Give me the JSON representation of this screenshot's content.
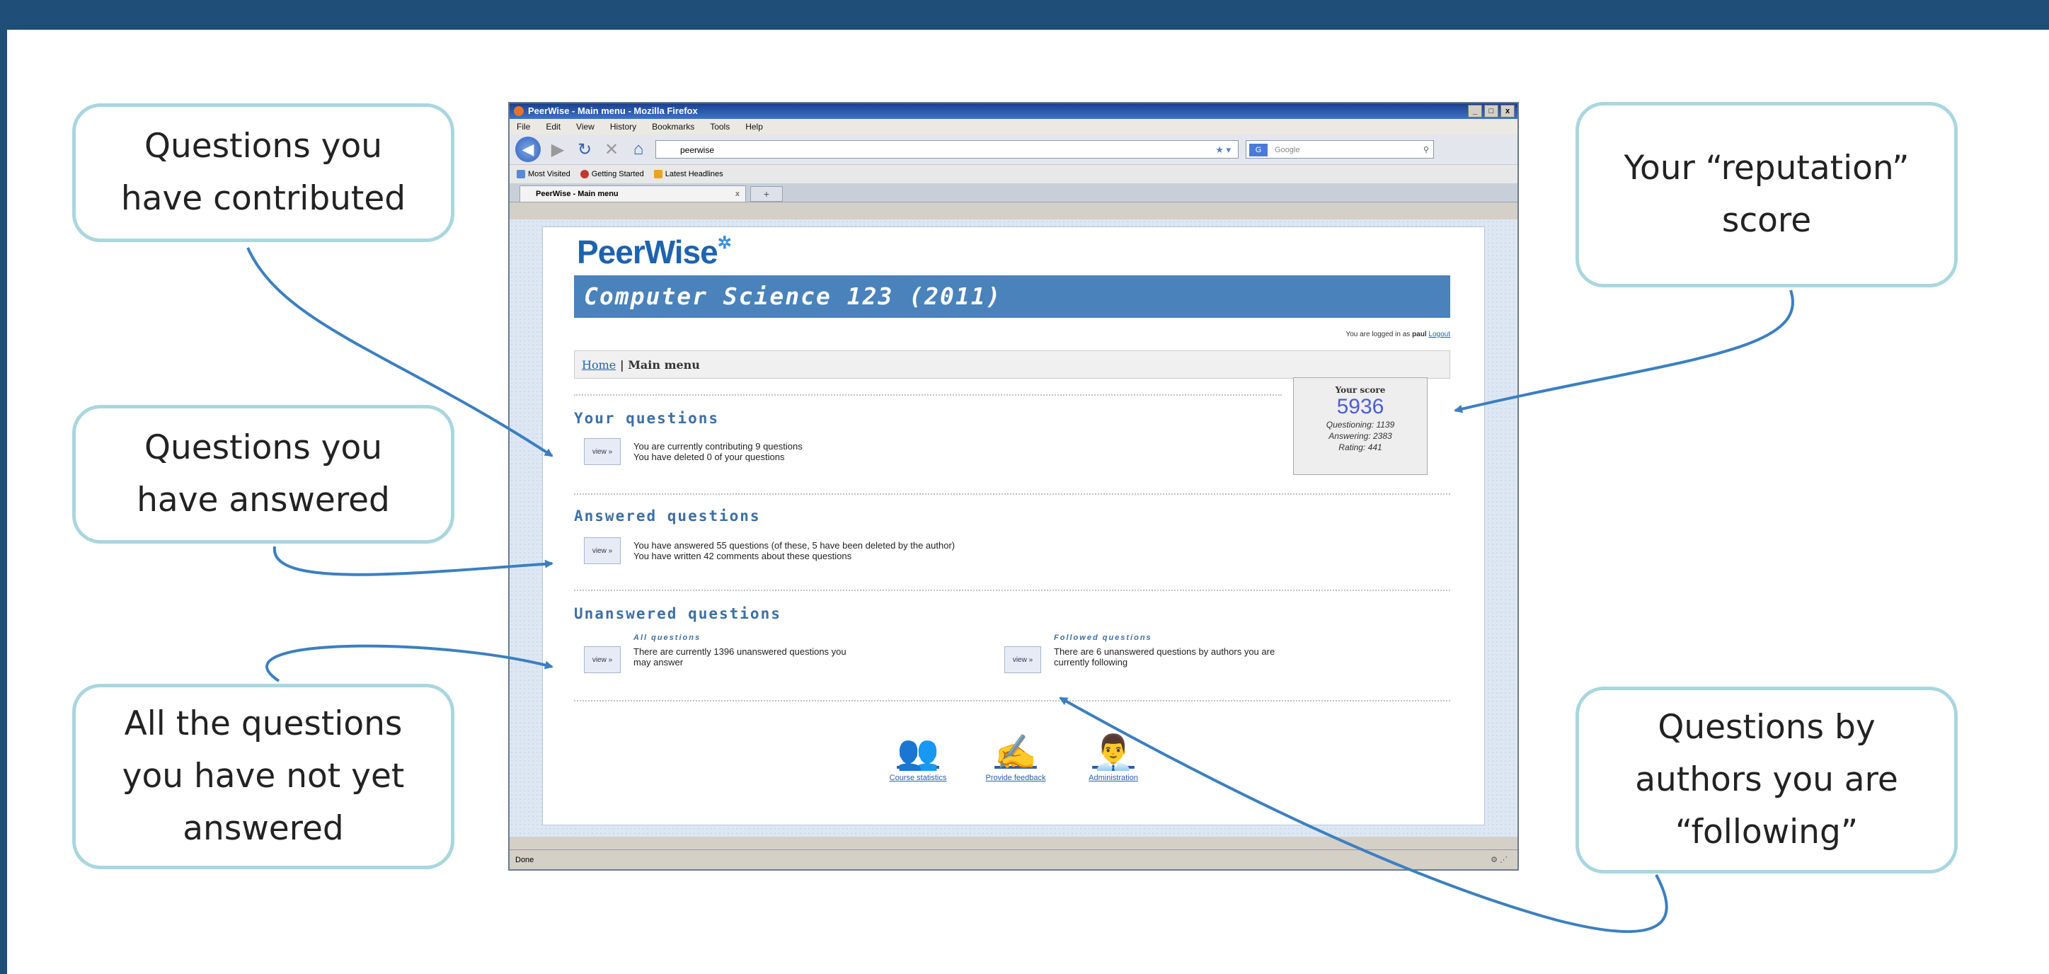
{
  "colors": {
    "background": "#1f4e79",
    "callout_border": "#a9d6df",
    "arrow": "#3b7fc0",
    "course_banner": "#4a82bb",
    "score": "#4b5ed4"
  },
  "callouts": {
    "contributed": "Questions you\nhave contributed",
    "answered": "Questions you\nhave answered",
    "not_answered": "All the questions\nyou have not yet\nanswered",
    "reputation": "Your “reputation”\nscore",
    "following": "Questions by\nauthors you are\n“following”"
  },
  "browser": {
    "window_title": "PeerWise - Main menu - Mozilla Firefox",
    "window_buttons": [
      "_",
      "□",
      "x"
    ],
    "menu": [
      "File",
      "Edit",
      "View",
      "History",
      "Bookmarks",
      "Tools",
      "Help"
    ],
    "url": "peerwise",
    "search_placeholder": "Google",
    "search_engine": "G",
    "bookmarks": [
      "Most Visited",
      "Getting Started",
      "Latest Headlines"
    ],
    "tab_title": "PeerWise - Main menu",
    "tab_close": "x",
    "tab_new": "+",
    "status": "Done"
  },
  "page": {
    "logo": "PeerWise",
    "course": "Computer Science 123 (2011)",
    "logged_in_prefix": "You are logged in as",
    "username": "paul",
    "logout": "Logout",
    "breadcrumb_home": "Home",
    "breadcrumb_current": "| Main menu",
    "score": {
      "label": "Your score",
      "value": "5936",
      "questioning": "Questioning: 1139",
      "answering": "Answering: 2383",
      "rating": "Rating: 441"
    },
    "view_label": "view »",
    "your_questions": {
      "title": "Your questions",
      "line1": "You are currently contributing 9 questions",
      "line2": "You have deleted 0 of your questions"
    },
    "answered_questions": {
      "title": "Answered questions",
      "line1": "You have answered 55 questions (of these, 5 have been deleted by the author)",
      "line2": "You have written 42 comments about these questions"
    },
    "unanswered_questions": {
      "title": "Unanswered questions",
      "all_title": "All questions",
      "all_desc": "There are currently 1396 unanswered questions you\nmay answer",
      "followed_title": "Followed questions",
      "followed_desc": "There are 6 unanswered questions by authors you are\ncurrently following"
    },
    "footer_links": [
      {
        "label": "Course statistics",
        "icon": "statistics-icon"
      },
      {
        "label": "Provide feedback",
        "icon": "feedback-icon"
      },
      {
        "label": "Administration",
        "icon": "administration-icon"
      }
    ]
  }
}
